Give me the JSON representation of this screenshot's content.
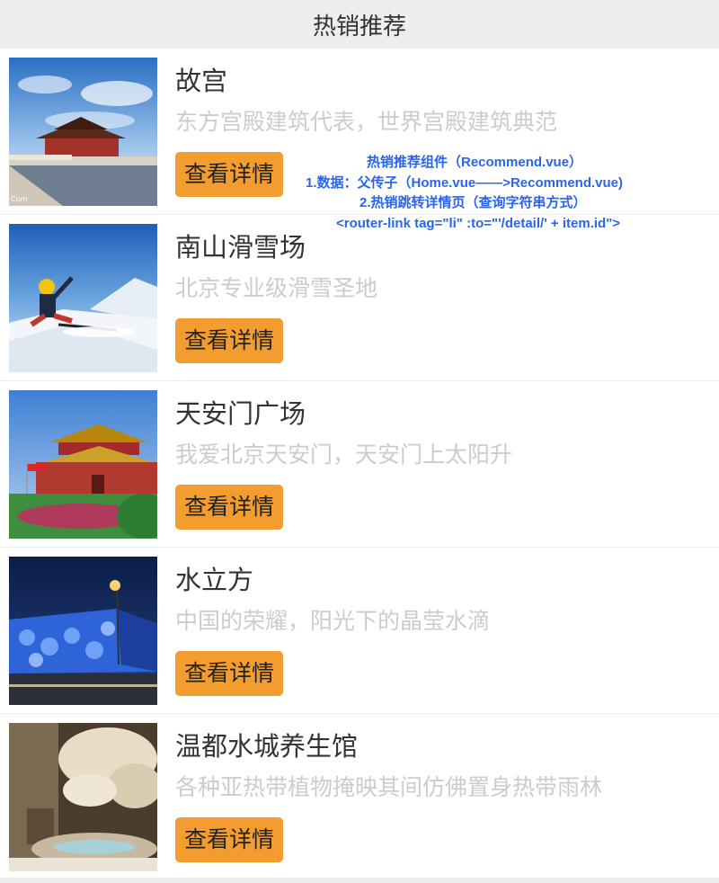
{
  "header": {
    "title": "热销推荐"
  },
  "button_label": "查看详情",
  "items": [
    {
      "title": "故宫",
      "desc": "东方宫殿建筑代表，世界宫殿建筑典范",
      "thumb_watermark": "Com"
    },
    {
      "title": "南山滑雪场",
      "desc": "北京专业级滑雪圣地"
    },
    {
      "title": "天安门广场",
      "desc": "我爱北京天安门，天安门上太阳升"
    },
    {
      "title": "水立方",
      "desc": "中国的荣耀，阳光下的晶莹水滴"
    },
    {
      "title": "温都水城养生馆",
      "desc": "各种亚热带植物掩映其间仿佛置身热带雨林"
    }
  ],
  "annotation": {
    "line1": "热销推荐组件（Recommend.vue）",
    "line2": "1.数据：父传子（Home.vue——>Recommend.vue)",
    "line3": "2.热销跳转详情页（查询字符串方式）",
    "line4": "<router-link tag=\"li\"  :to=\"'/detail/' + item.id\">"
  },
  "colors": {
    "header_bg": "#eeeeee",
    "button_bg": "#f39c2f",
    "desc_text": "#cccccc",
    "annotation_text": "#2b66e8"
  }
}
